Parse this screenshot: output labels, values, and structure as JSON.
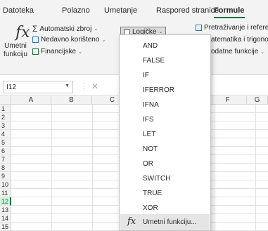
{
  "tabs": [
    {
      "label": "Datoteka"
    },
    {
      "label": "Polazno"
    },
    {
      "label": "Umetanje"
    },
    {
      "label": "Raspored stranice"
    },
    {
      "label": "Formule"
    }
  ],
  "ribbon": {
    "insert_function_label_1": "Umetni",
    "insert_function_label_2": "funkciju",
    "autosum": "Automatski zbroj",
    "recent": "Nedavno korišteno",
    "financial": "Financijske",
    "logical": "Logičke",
    "lookup": "Pretraživanje i refere",
    "math": "atematika i trigono",
    "more": "odatne funkcije"
  },
  "formula_bar": {
    "name_box": "I12"
  },
  "columns": [
    "A",
    "B",
    "C",
    "F",
    "G"
  ],
  "rows": [
    "1",
    "2",
    "3",
    "4",
    "5",
    "6",
    "7",
    "8",
    "9",
    "10",
    "11",
    "12",
    "13",
    "14",
    "15"
  ],
  "selected_row": "12",
  "dropdown": {
    "items": [
      "AND",
      "FALSE",
      "IF",
      "IFERROR",
      "IFNA",
      "IFS",
      "LET",
      "NOT",
      "OR",
      "SWITCH",
      "TRUE",
      "XOR"
    ],
    "footer": "Umetni funkciju..."
  },
  "colors": {
    "accent": "#1d6e41",
    "selected_row_bg": "#d3f0e0"
  }
}
